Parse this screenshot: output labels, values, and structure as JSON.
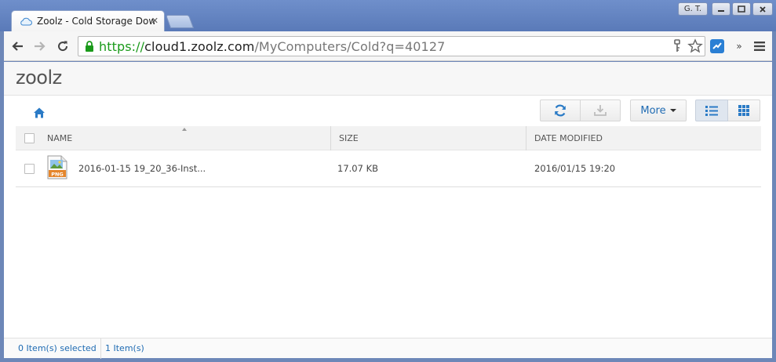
{
  "browser": {
    "tab_title": "Zoolz - Cold Storage Dow",
    "user_badge": "G. T.",
    "url_scheme": "https://",
    "url_host": "cloud1.zoolz.com",
    "url_path": "/MyComputers/Cold?q=40127"
  },
  "app": {
    "logo": "zoolz",
    "more_label": "More"
  },
  "table": {
    "headers": {
      "name": "NAME",
      "size": "SIZE",
      "date": "DATE MODIFIED"
    },
    "rows": [
      {
        "name": "2016-01-15 19_20_36-Inst...",
        "size": "17.07 KB",
        "date": "2016/01/15 19:20",
        "type": "PNG"
      }
    ]
  },
  "status": {
    "selected": "0 Item(s) selected",
    "count": "1 Item(s)"
  },
  "colors": {
    "accent": "#1f6bb3",
    "secure": "#1a9a1a",
    "file_icon": "#e5862c"
  }
}
